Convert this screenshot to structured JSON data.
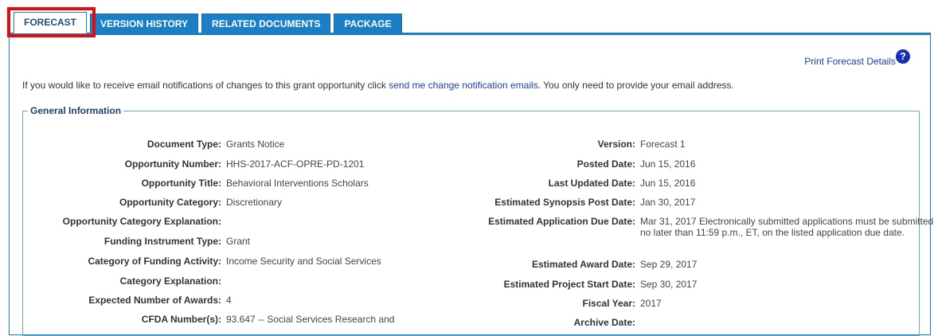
{
  "tabs": [
    {
      "label": "FORECAST",
      "active": true
    },
    {
      "label": "VERSION HISTORY",
      "active": false
    },
    {
      "label": "RELATED DOCUMENTS",
      "active": false
    },
    {
      "label": "PACKAGE",
      "active": false
    }
  ],
  "header": {
    "print_link": "Print Forecast Details",
    "help_glyph": "?"
  },
  "notify": {
    "prefix": "If you would like to receive email notifications of changes to this grant opportunity click ",
    "link": "send me change notification emails",
    "suffix": ". You only need to provide your email address."
  },
  "general": {
    "legend": "General Information",
    "left": [
      {
        "label": "Document Type:",
        "value": "Grants Notice"
      },
      {
        "label": "Opportunity Number:",
        "value": "HHS-2017-ACF-OPRE-PD-1201"
      },
      {
        "label": "Opportunity Title:",
        "value": "Behavioral Interventions Scholars"
      },
      {
        "label": "Opportunity Category:",
        "value": "Discretionary"
      },
      {
        "label": "Opportunity Category Explanation:",
        "value": ""
      },
      {
        "label": "Funding Instrument Type:",
        "value": "Grant"
      },
      {
        "label": "Category of Funding Activity:",
        "value": "Income Security and Social Services"
      },
      {
        "label": "Category Explanation:",
        "value": ""
      },
      {
        "label": "Expected Number of Awards:",
        "value": "4"
      },
      {
        "label": "CFDA Number(s):",
        "value": "93.647 -- Social Services Research and"
      }
    ],
    "right": [
      {
        "label": "Version:",
        "value": "Forecast 1"
      },
      {
        "label": "Posted Date:",
        "value": "Jun 15, 2016"
      },
      {
        "label": "Last Updated Date:",
        "value": "Jun 15, 2016"
      },
      {
        "label": "Estimated Synopsis Post Date:",
        "value": "Jan 30, 2017"
      },
      {
        "label": "Estimated Application Due Date:",
        "value": "Mar 31, 2017  Electronically submitted applications must be submitted no later than 11:59 p.m., ET, on the listed application due date."
      },
      {
        "label": "Estimated Award Date:",
        "value": "Sep 29, 2017"
      },
      {
        "label": "Estimated Project Start Date:",
        "value": "Sep 30, 2017"
      },
      {
        "label": "Fiscal Year:",
        "value": "2017"
      },
      {
        "label": "Archive Date:",
        "value": ""
      }
    ]
  }
}
